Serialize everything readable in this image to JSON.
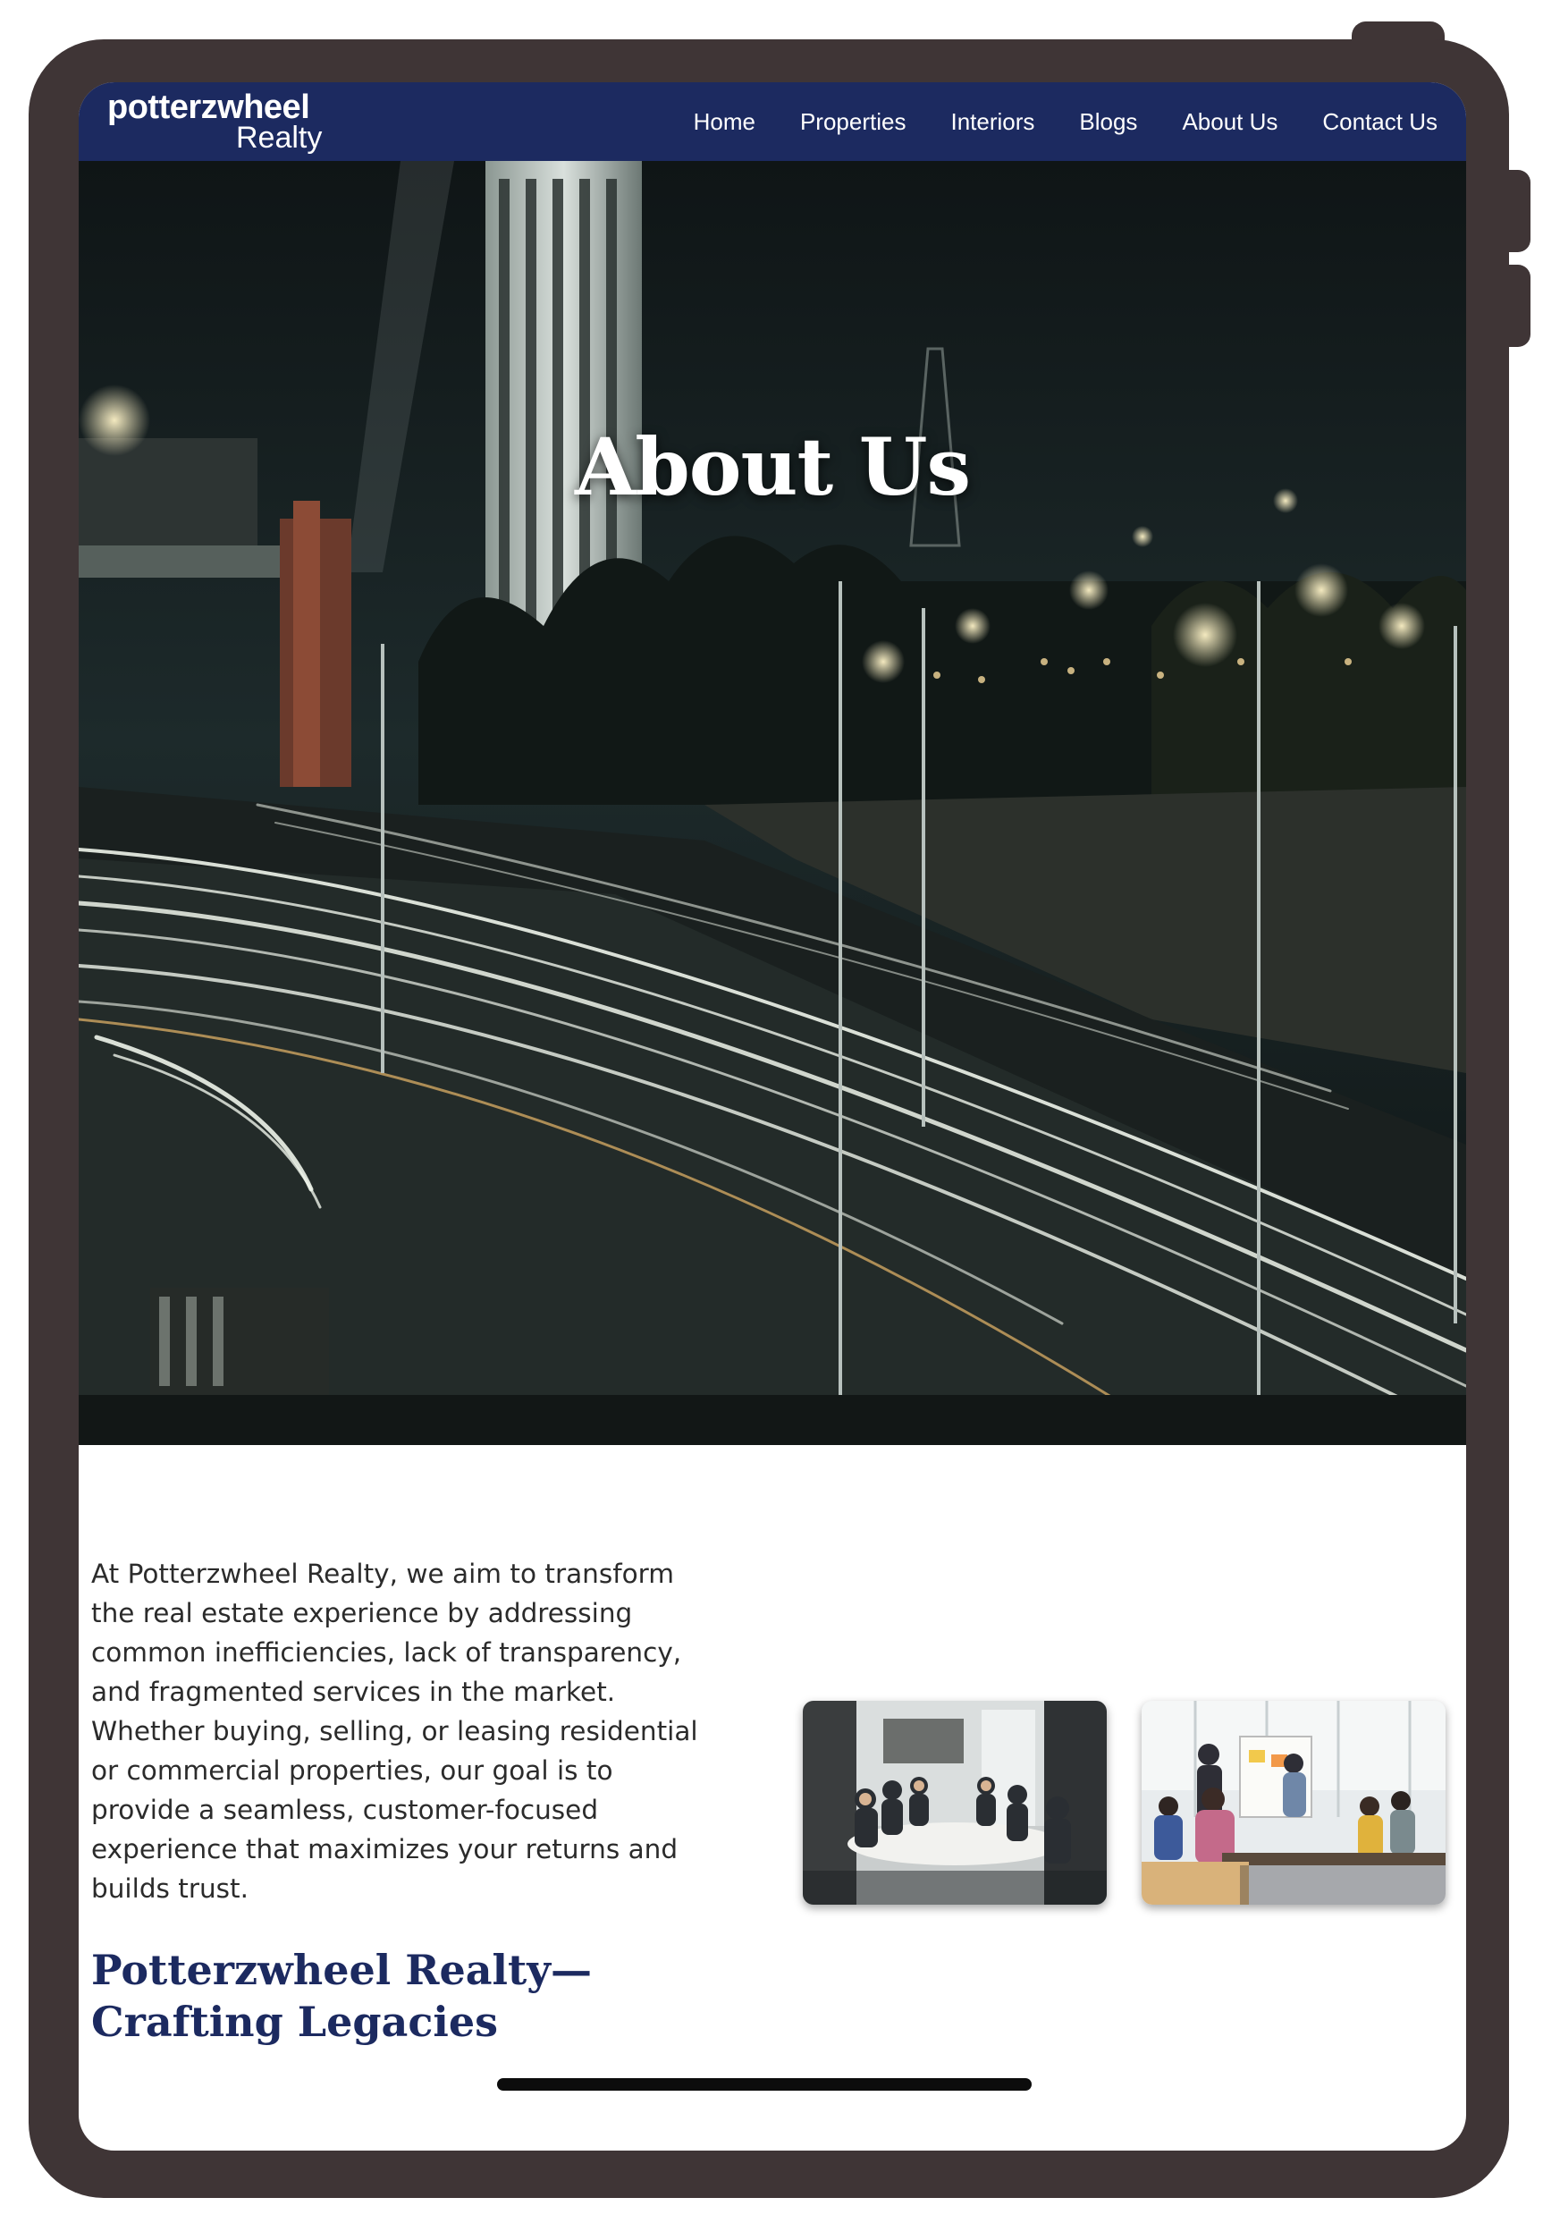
{
  "brand": {
    "logo_main": "potterzwheel",
    "logo_sub": "Realty",
    "nav_color": "#1c2a60",
    "frame_color": "#3f3536"
  },
  "nav": {
    "items": [
      {
        "label": "Home"
      },
      {
        "label": "Properties"
      },
      {
        "label": "Interiors"
      },
      {
        "label": "Blogs"
      },
      {
        "label": "About Us"
      },
      {
        "label": "Contact Us"
      }
    ]
  },
  "hero": {
    "title": "About Us",
    "image": "night-city-highway-light-trails"
  },
  "content": {
    "intro": "At Potterzwheel Realty, we aim to transform the real estate experience by addressing common inefficiencies, lack of transparency, and fragmented services in the market. Whether buying, selling, or leasing residential or commercial properties, our goal is to provide a seamless, customer-focused experience that maximizes your returns and builds trust.",
    "heading": "Potterzwheel Realty—Crafting Legacies",
    "photos": [
      {
        "subject": "team-meeting-conference-table"
      },
      {
        "subject": "team-brainstorm-whiteboard"
      }
    ]
  }
}
